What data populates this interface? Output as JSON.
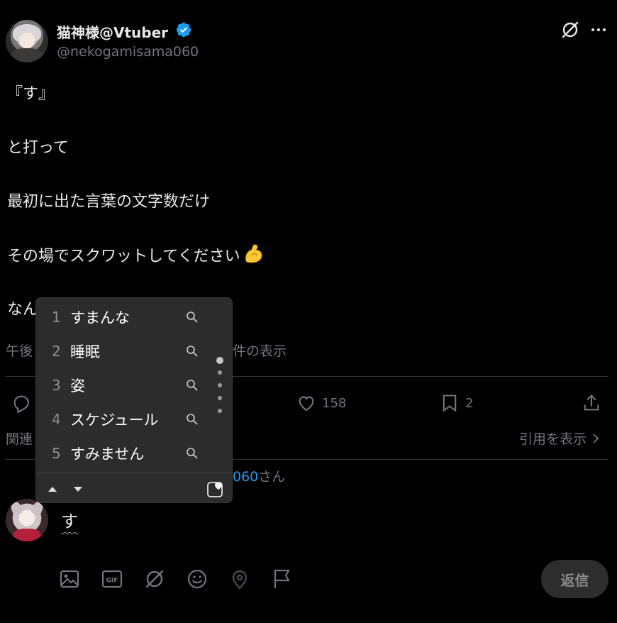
{
  "author": {
    "display_name": "猫神様@Vtuber",
    "handle": "@nekogamisama060"
  },
  "post": {
    "lines": [
      "『す』",
      "と打って",
      "最初に出た言葉の文字数だけ",
      "その場でスクワットしてください",
      "なん"
    ],
    "emoji": "flexed-biceps",
    "meta_left": "午後",
    "meta_right": "件の表示"
  },
  "actions": {
    "likes": "158",
    "bookmarks": "2"
  },
  "related_label": "関連",
  "quotes_link": "引用を表示",
  "reply_to": {
    "handle_fragment": "060",
    "suffix": "さん"
  },
  "composer": {
    "text": "す",
    "reply_button": "返信",
    "tools": [
      "image-icon",
      "gif-icon",
      "grok-icon",
      "emoji-icon",
      "location-icon",
      "flag-icon"
    ]
  },
  "ime": {
    "candidates": [
      {
        "num": "1",
        "word": "すまんな"
      },
      {
        "num": "2",
        "word": "睡眠"
      },
      {
        "num": "3",
        "word": "姿"
      },
      {
        "num": "4",
        "word": "スケジュール"
      },
      {
        "num": "5",
        "word": "すみません"
      }
    ]
  },
  "colors": {
    "background": "#000000",
    "text": "#e7e9ea",
    "muted": "#71767b",
    "accent": "#1d9bf0",
    "popup": "#2c2c2c"
  }
}
